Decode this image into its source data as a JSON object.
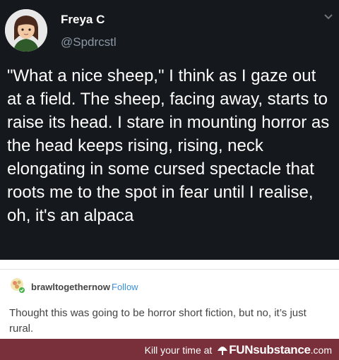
{
  "tweet": {
    "display_name": "Freya C",
    "handle": "@Spdrcstl",
    "text": "\"What a nice sheep,\" I think as I gaze out at a field. The sheep, facing away, starts to raise its head. I stare in mounting horror as the head keeps rising, rising, neck elongating in some cursed spectacle that roots me to the spot in fear until I realise, oh, it's an alpaca"
  },
  "reply": {
    "username": "brawltogethernow",
    "follow_label": "Follow",
    "text": "Thought this was going to be horror short fiction, but no, it’s just rural."
  },
  "footer": {
    "tagline": "Kill your time at",
    "brand": "FUNsubstance",
    "domain": ".com"
  },
  "colors": {
    "tweet_background": "#15181c",
    "handle_gray": "#8b98a5",
    "follow_blue": "#3a8fd5",
    "footer_background": "#79303a"
  },
  "icons": [
    "avatar-cartoon",
    "chevron-down-icon",
    "reblog-badge-icon"
  ]
}
